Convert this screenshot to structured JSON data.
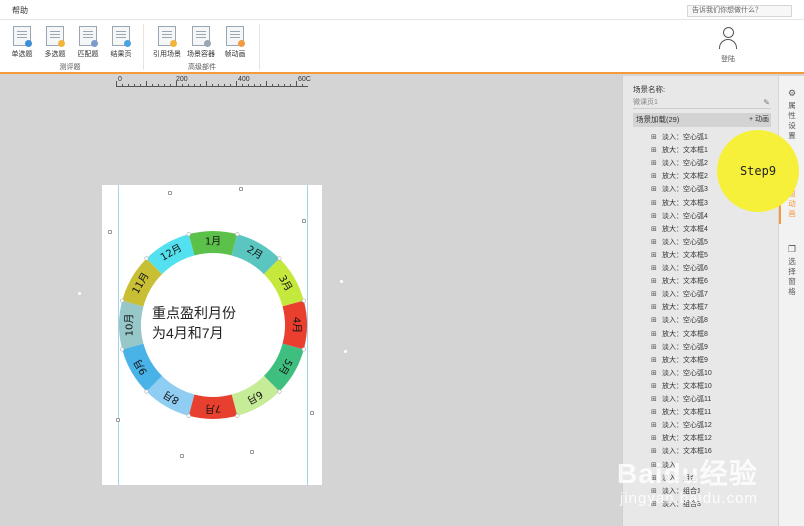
{
  "topbar": {
    "menu_help": "帮助",
    "search_placeholder": "告诉我们你想做什么？"
  },
  "ribbon": {
    "group1": {
      "label": "测评题",
      "buttons": [
        "单选题",
        "多选题",
        "匹配题",
        "结果页"
      ]
    },
    "group2": {
      "label": "高级部件",
      "buttons": [
        "引用场景",
        "场景容器",
        "帧动画"
      ]
    },
    "login_label": "登陆"
  },
  "ruler": {
    "labels": [
      "0",
      "200",
      "400",
      "60C"
    ]
  },
  "canvas": {
    "center_text_line1": "重点盈利月份",
    "center_text_line2": "为4月和7月",
    "months": [
      {
        "label": "1月",
        "color": "#5cc14a"
      },
      {
        "label": "2月",
        "color": "#5bc6c0"
      },
      {
        "label": "3月",
        "color": "#c5e83c"
      },
      {
        "label": "4月",
        "color": "#ea3e2f"
      },
      {
        "label": "5月",
        "color": "#3fbf7f"
      },
      {
        "label": "6月",
        "color": "#c6ec97"
      },
      {
        "label": "7月",
        "color": "#e8402e"
      },
      {
        "label": "8月",
        "color": "#8fcdf2"
      },
      {
        "label": "9月",
        "color": "#49b3e8"
      },
      {
        "label": "10月",
        "color": "#97c7c9"
      },
      {
        "label": "11月",
        "color": "#c8bf35"
      },
      {
        "label": "12月",
        "color": "#54e1ef"
      }
    ]
  },
  "panel": {
    "scene_label": "场景名称:",
    "scene_value": "微课页1",
    "anim_header": "场景加载(29)",
    "add_anim": "+ 动画",
    "anim_items": [
      "淡入：空心弧1",
      "放大：文本框1",
      "淡入：空心弧2",
      "放大：文本框2",
      "淡入：空心弧3",
      "放大：文本框3",
      "淡入：空心弧4",
      "放大：文本框4",
      "淡入：空心弧5",
      "放大：文本框5",
      "淡入：空心弧6",
      "放大：文本框6",
      "淡入：空心弧7",
      "放大：文本框7",
      "淡入：空心弧8",
      "放大：文本框8",
      "淡入：空心弧9",
      "放大：文本框9",
      "淡入：空心弧10",
      "放大：文本框10",
      "淡入：空心弧11",
      "放大：文本框11",
      "淡入：空心弧12",
      "放大：文本框12",
      "淡入：文本框16",
      "淡入",
      "淡入：组合",
      "淡入：组合1",
      "淡入：组合3"
    ]
  },
  "sidetabs": {
    "props": "属性设置",
    "anim": "页面动画",
    "select": "选择窗格"
  },
  "badge": {
    "step": "Step9"
  },
  "watermark": {
    "brand": "Baidu经验",
    "url": "jingyan.baidu.com"
  },
  "colors": {
    "accent": "#f39a3d",
    "badge": "#f7f03a"
  }
}
